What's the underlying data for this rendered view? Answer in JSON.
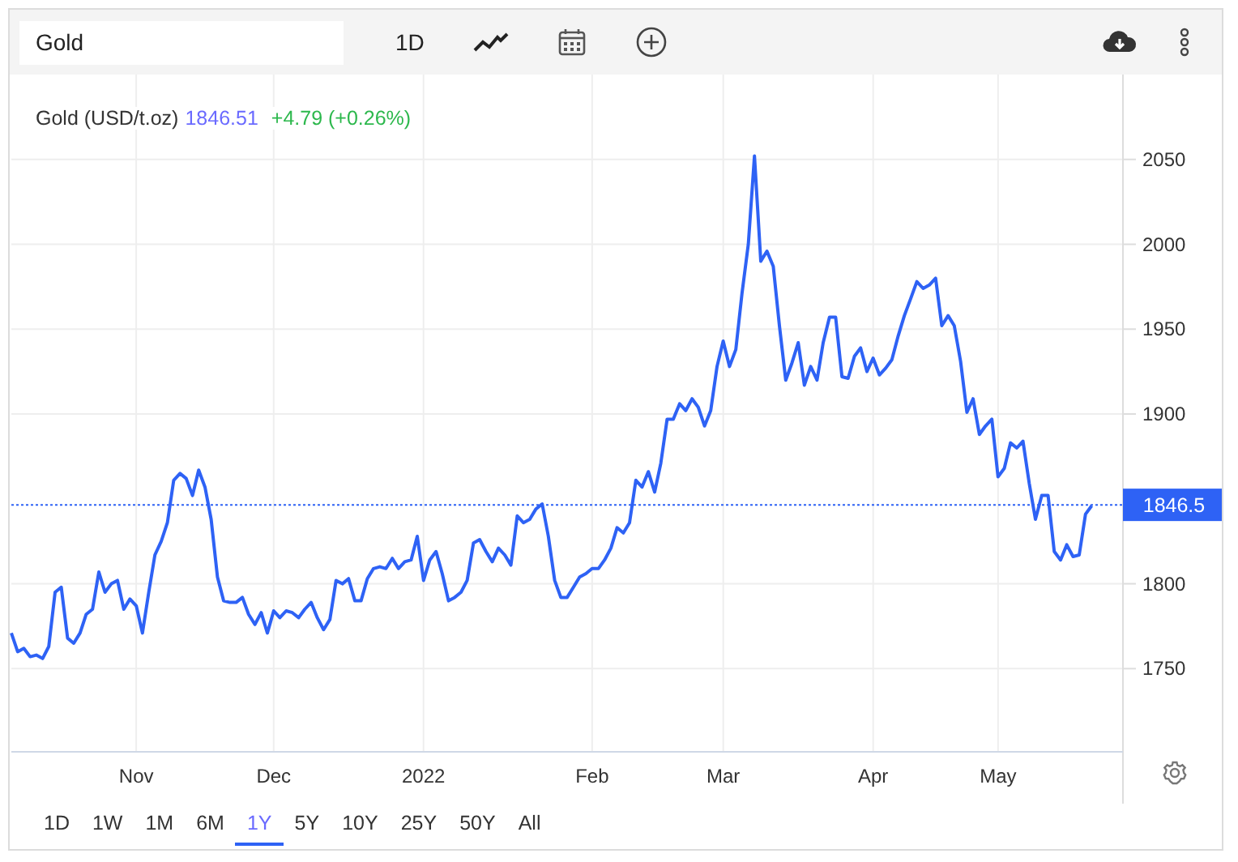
{
  "toolbar": {
    "search": {
      "value": "Gold"
    },
    "interval": "1D"
  },
  "chart": {
    "legend": {
      "name": "Gold (USD/t.oz)",
      "price": "1846.51",
      "change": "+4.79 (+0.26%)"
    },
    "chart_data": {
      "type": "line",
      "grid": true,
      "ref_lines": [
        {
          "axis": "y",
          "value": 1846.5,
          "label": "1846.5",
          "color": "#2e62f5"
        }
      ],
      "categories": [
        null,
        null,
        null,
        null,
        null,
        null,
        null,
        null,
        null,
        null,
        null,
        null,
        null,
        null,
        null,
        null,
        null,
        null,
        null,
        null,
        "Nov",
        null,
        null,
        null,
        null,
        null,
        null,
        null,
        null,
        null,
        null,
        null,
        null,
        null,
        null,
        null,
        null,
        null,
        null,
        null,
        null,
        null,
        "Dec",
        null,
        null,
        null,
        null,
        null,
        null,
        null,
        null,
        null,
        null,
        null,
        null,
        null,
        null,
        null,
        null,
        null,
        null,
        null,
        null,
        null,
        null,
        null,
        "2022",
        null,
        null,
        null,
        null,
        null,
        null,
        null,
        null,
        null,
        null,
        null,
        null,
        null,
        null,
        null,
        null,
        null,
        null,
        null,
        null,
        null,
        null,
        null,
        null,
        null,
        null,
        "Feb",
        null,
        null,
        null,
        null,
        null,
        null,
        null,
        null,
        null,
        null,
        null,
        null,
        null,
        null,
        null,
        null,
        null,
        null,
        null,
        null,
        "Mar",
        null,
        null,
        null,
        null,
        null,
        null,
        null,
        null,
        null,
        null,
        null,
        null,
        null,
        null,
        null,
        null,
        null,
        null,
        null,
        null,
        null,
        null,
        null,
        "Apr",
        null,
        null,
        null,
        null,
        null,
        null,
        null,
        null,
        null,
        null,
        null,
        null,
        null,
        null,
        null,
        null,
        null,
        null,
        null,
        "May",
        null,
        null,
        null,
        null,
        null,
        null,
        null,
        null,
        null,
        null,
        null,
        null,
        null,
        null,
        null
      ],
      "ylim": [
        1701,
        2100
      ],
      "yticks": [
        1750,
        1800,
        1900,
        1950,
        2000,
        2050
      ],
      "series": [
        {
          "color": "#2e62f5",
          "values": [
            1771,
            1760,
            1762,
            1757,
            1758,
            1756,
            1763,
            1795,
            1798,
            1768,
            1765,
            1771,
            1782,
            1785,
            1807,
            1795,
            1800,
            1802,
            1785,
            1791,
            1787,
            1771,
            1795,
            1817,
            1825,
            1836,
            1861,
            1865,
            1862,
            1852,
            1867,
            1857,
            1838,
            1804,
            1790,
            1789,
            1789,
            1792,
            1782,
            1776,
            1783,
            1771,
            1784,
            1780,
            1784,
            1783,
            1780,
            1785,
            1789,
            1780,
            1773,
            1779,
            1802,
            1800,
            1803,
            1790,
            1790,
            1803,
            1809,
            1810,
            1809,
            1815,
            1809,
            1813,
            1814,
            1828,
            1802,
            1814,
            1819,
            1806,
            1790,
            1792,
            1795,
            1802,
            1824,
            1826,
            1819,
            1813,
            1821,
            1817,
            1811,
            1840,
            1836,
            1838,
            1844,
            1847,
            1828,
            1802,
            1792,
            1792,
            1798,
            1804,
            1806,
            1809,
            1809,
            1814,
            1821,
            1833,
            1830,
            1836,
            1861,
            1857,
            1866,
            1854,
            1871,
            1897,
            1897,
            1906,
            1902,
            1909,
            1904,
            1893,
            1902,
            1928,
            1943,
            1928,
            1938,
            1971,
            2000,
            2052,
            1990,
            1996,
            1987,
            1952,
            1920,
            1930,
            1942,
            1917,
            1928,
            1920,
            1942,
            1957,
            1957,
            1922,
            1921,
            1934,
            1939,
            1925,
            1933,
            1923,
            1927,
            1932,
            1946,
            1958,
            1968,
            1978,
            1974,
            1976,
            1980,
            1952,
            1958,
            1952,
            1931,
            1901,
            1909,
            1888,
            1893,
            1897,
            1863,
            1868,
            1883,
            1880,
            1884,
            1859,
            1838,
            1852,
            1852,
            1819,
            1814,
            1823,
            1816,
            1817,
            1841,
            1846
          ]
        }
      ]
    }
  },
  "ranges": [
    {
      "label": "1D",
      "selected": false
    },
    {
      "label": "1W",
      "selected": false
    },
    {
      "label": "1M",
      "selected": false
    },
    {
      "label": "6M",
      "selected": false
    },
    {
      "label": "1Y",
      "selected": true
    },
    {
      "label": "5Y",
      "selected": false
    },
    {
      "label": "10Y",
      "selected": false
    },
    {
      "label": "25Y",
      "selected": false
    },
    {
      "label": "50Y",
      "selected": false
    },
    {
      "label": "All",
      "selected": false
    }
  ]
}
